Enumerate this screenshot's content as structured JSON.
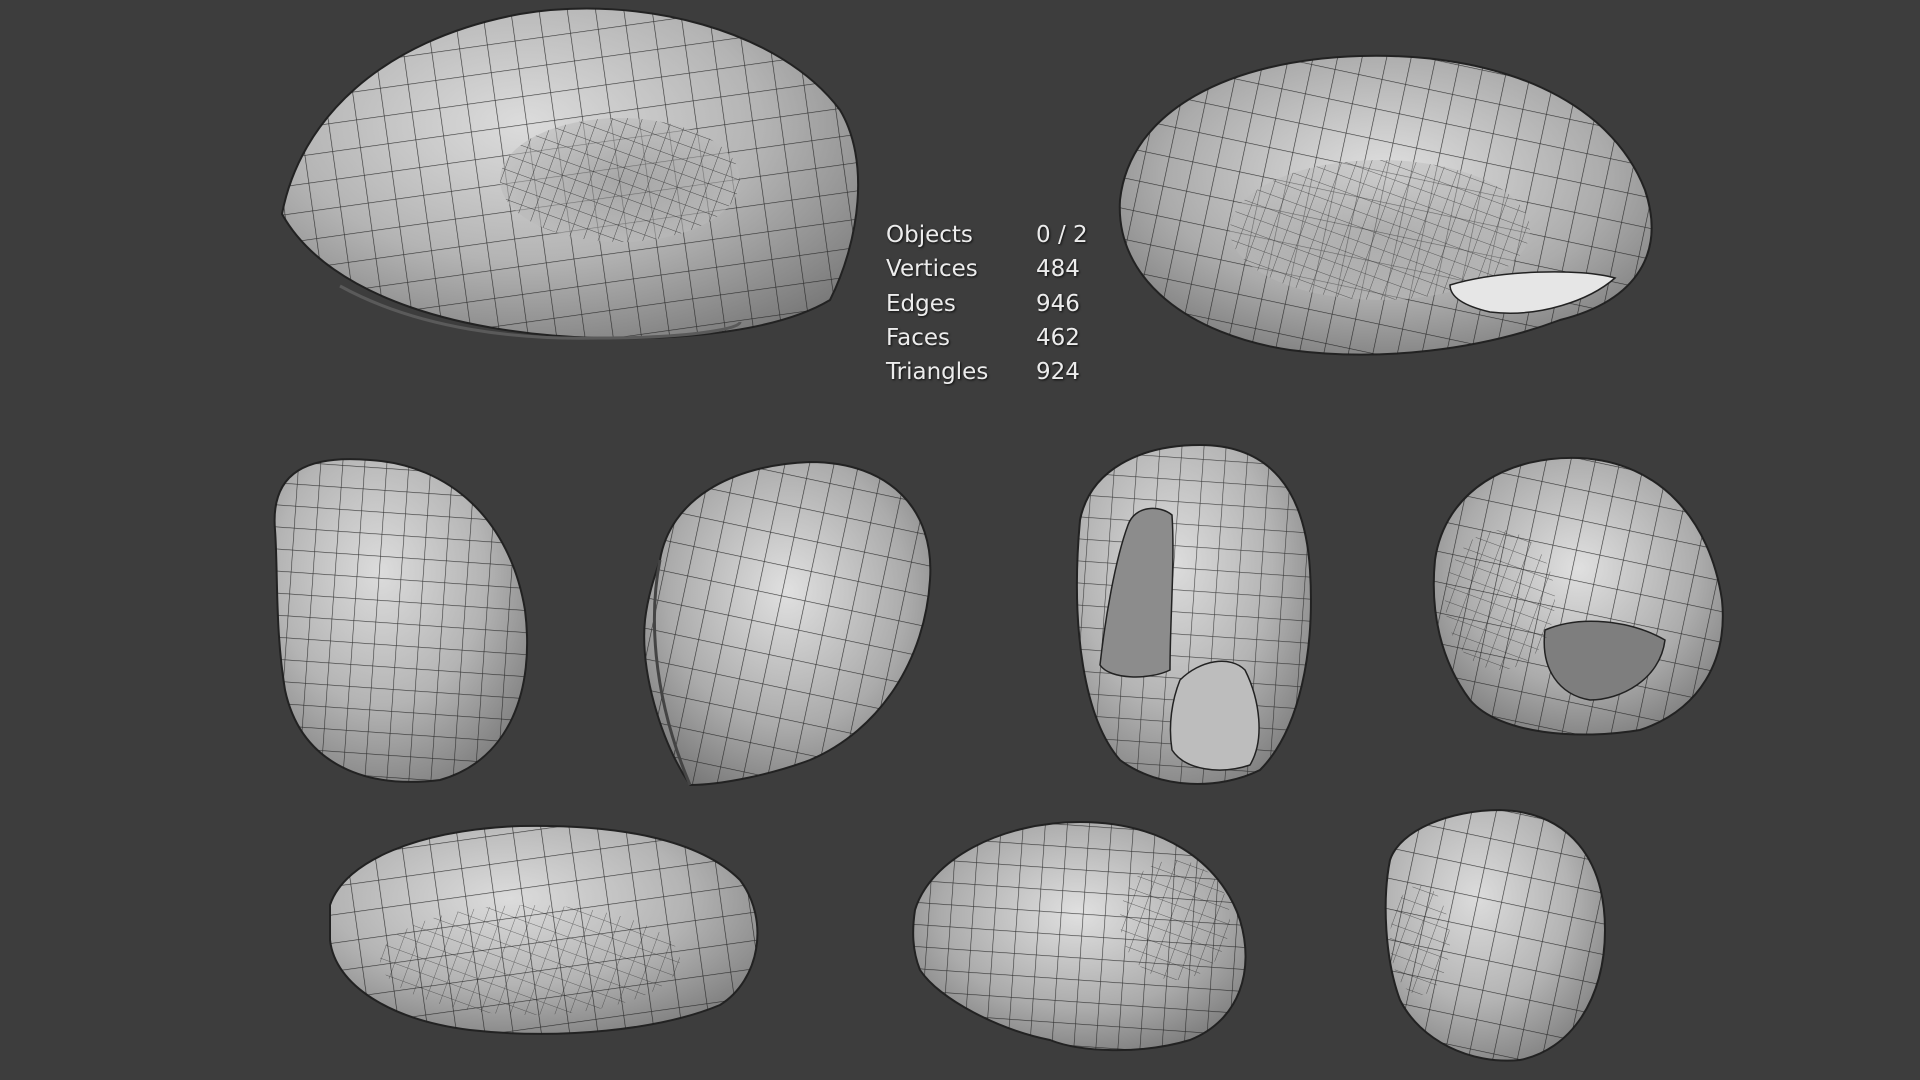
{
  "viewport": {
    "background": "#3d3d3d",
    "object_count": 9,
    "mesh_style": "wireframe overlay on solid grey shading"
  },
  "statistics": {
    "objects": {
      "label": "Objects",
      "value": "0 / 2"
    },
    "vertices": {
      "label": "Vertices",
      "value": "484"
    },
    "edges": {
      "label": "Edges",
      "value": "946"
    },
    "faces": {
      "label": "Faces",
      "value": "462"
    },
    "triangles": {
      "label": "Triangles",
      "value": "924"
    }
  },
  "colors": {
    "text": "#ececec",
    "mesh_fill_light": "#d6d6d6",
    "mesh_fill_dark": "#6e6e6e",
    "wire": "#1e1e1e"
  }
}
